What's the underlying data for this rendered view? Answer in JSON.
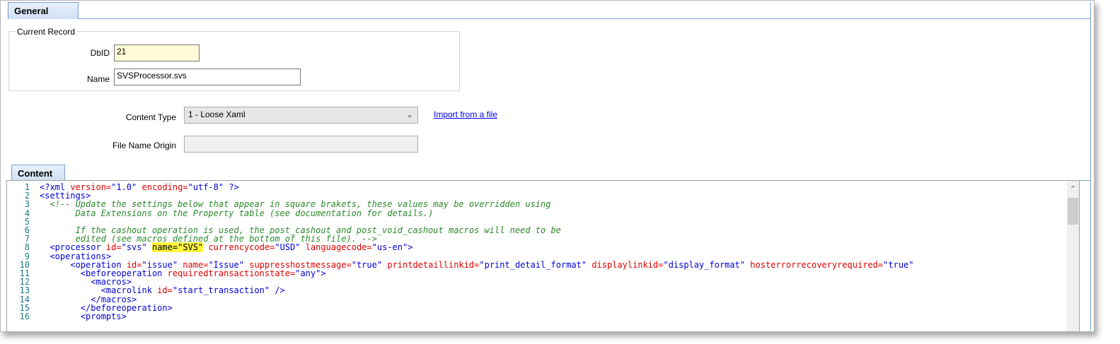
{
  "tabs": {
    "general": "General",
    "content": "Content"
  },
  "current_record": {
    "title": "Current Record",
    "dbid_label": "DbID",
    "dbid_value": "21",
    "name_label": "Name",
    "name_value": "SVSProcessor.svs"
  },
  "content_type": {
    "label": "Content Type",
    "value": "1 - Loose Xaml",
    "import_link": "Import from a file"
  },
  "file_name_origin": {
    "label": "File Name Origin",
    "value": ""
  },
  "editor": {
    "line_numbers": [
      "1",
      "2",
      "3",
      "4",
      "5",
      "6",
      "7",
      "8",
      "9",
      "10",
      "11",
      "12",
      "13",
      "14",
      "15",
      "16"
    ],
    "lines": [
      [
        {
          "t": "t",
          "s": "<?xml"
        },
        {
          "t": "a",
          "s": " version="
        },
        {
          "t": "v",
          "s": "\"1.0\""
        },
        {
          "t": "a",
          "s": " encoding="
        },
        {
          "t": "v",
          "s": "\"utf-8\""
        },
        {
          "t": "t",
          "s": " ?>"
        }
      ],
      [
        {
          "t": "t",
          "s": "<settings>"
        }
      ],
      [
        {
          "t": "c",
          "s": "  <!-- Update the settings below that appear in square brakets, these values may be overridden using"
        }
      ],
      [
        {
          "t": "c",
          "s": "       Data Extensions on the Property table (see documentation for details.)"
        }
      ],
      [
        {
          "t": "c",
          "s": ""
        }
      ],
      [
        {
          "t": "c",
          "s": "       If the cashout operation is used, the post_cashout and post_void_cashout macros will need to be"
        }
      ],
      [
        {
          "t": "c",
          "s": "       edited (see macros defined at the bottom of this file). -->"
        }
      ],
      [
        {
          "t": "t",
          "s": "  <processor"
        },
        {
          "t": "a",
          "s": " id="
        },
        {
          "t": "v",
          "s": "\"svs\""
        },
        {
          "t": "p",
          "s": " "
        },
        {
          "t": "hl",
          "s": "name=\"SVS\""
        },
        {
          "t": "a",
          "s": " currencycode="
        },
        {
          "t": "v",
          "s": "\"USD\""
        },
        {
          "t": "a",
          "s": " languagecode="
        },
        {
          "t": "v",
          "s": "\"us-en\""
        },
        {
          "t": "t",
          "s": ">"
        }
      ],
      [
        {
          "t": "t",
          "s": "  <operations>"
        }
      ],
      [
        {
          "t": "t",
          "s": "      <operation"
        },
        {
          "t": "a",
          "s": " id="
        },
        {
          "t": "v",
          "s": "\"issue\""
        },
        {
          "t": "a",
          "s": " name="
        },
        {
          "t": "v",
          "s": "\"Issue\""
        },
        {
          "t": "a",
          "s": " suppresshostmessage="
        },
        {
          "t": "v",
          "s": "\"true\""
        },
        {
          "t": "a",
          "s": " printdetaillinkid="
        },
        {
          "t": "v",
          "s": "\"print_detail_format\""
        },
        {
          "t": "a",
          "s": " displaylinkid="
        },
        {
          "t": "v",
          "s": "\"display_format\""
        },
        {
          "t": "a",
          "s": " hosterrorrecoveryrequired="
        },
        {
          "t": "v",
          "s": "\"true\""
        }
      ],
      [
        {
          "t": "t",
          "s": "        <beforeoperation"
        },
        {
          "t": "a",
          "s": " requiredtransactionstate="
        },
        {
          "t": "v",
          "s": "\"any\""
        },
        {
          "t": "t",
          "s": ">"
        }
      ],
      [
        {
          "t": "t",
          "s": "          <macros>"
        }
      ],
      [
        {
          "t": "t",
          "s": "            <macrolink"
        },
        {
          "t": "a",
          "s": " id="
        },
        {
          "t": "v",
          "s": "\"start_transaction\""
        },
        {
          "t": "t",
          "s": " />"
        }
      ],
      [
        {
          "t": "t",
          "s": "          </macros>"
        }
      ],
      [
        {
          "t": "t",
          "s": "        </beforeoperation>"
        }
      ],
      [
        {
          "t": "t",
          "s": "        <prompts>"
        }
      ]
    ]
  }
}
